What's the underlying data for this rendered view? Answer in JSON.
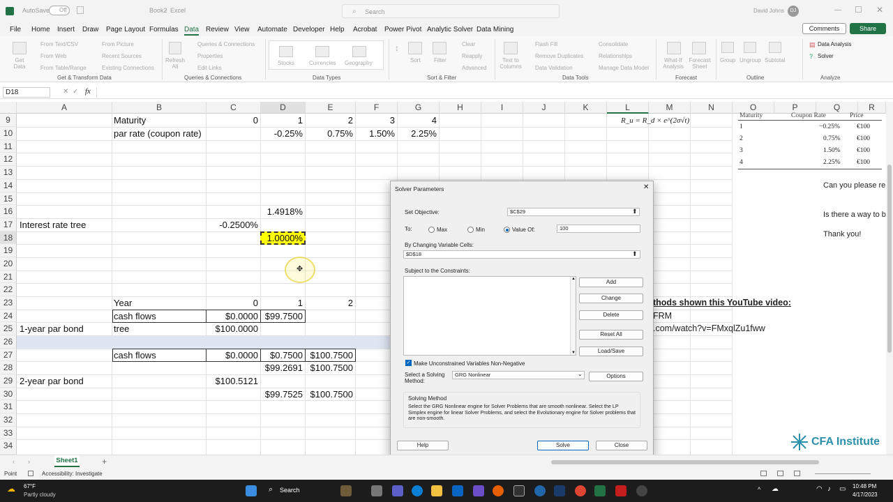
{
  "titlebar": {
    "autosave": "AutoSave",
    "autosave_state": "Off",
    "filename": "Book2",
    "app": "Excel",
    "search": "Search",
    "user": "David Johns",
    "initials": "DJ"
  },
  "menu": [
    "File",
    "Home",
    "Insert",
    "Draw",
    "Page Layout",
    "Formulas",
    "Data",
    "Review",
    "View",
    "Automate",
    "Developer",
    "Help",
    "Acrobat",
    "Power Pivot",
    "Analytic Solver",
    "Data Mining"
  ],
  "menu_right": {
    "comments": "Comments",
    "share": "Share"
  },
  "ribbon": {
    "get_data": "Get Data",
    "from_text": "From Text/CSV",
    "from_web": "From Web",
    "from_table": "From Table/Range",
    "from_picture": "From Picture",
    "recent_sources": "Recent Sources",
    "existing_connections": "Existing Connections",
    "refresh_all": "Refresh All",
    "queries": "Queries & Connections",
    "properties": "Properties",
    "edit_links": "Edit Links",
    "stocks": "Stocks",
    "currencies": "Currencies",
    "geography": "Geography",
    "sort": "Sort",
    "filter": "Filter",
    "clear": "Clear",
    "reapply": "Reapply",
    "advanced": "Advanced",
    "text_to_columns": "Text to Columns",
    "flash_fill": "Flash Fill",
    "remove_duplicates": "Remove Duplicates",
    "data_validation": "Data Validation",
    "consolidate": "Consolidate",
    "relationships": "Relationships",
    "manage_model": "Manage Data Model",
    "what_if": "What-If Analysis",
    "forecast_sheet": "Forecast Sheet",
    "group": "Group",
    "ungroup": "Ungroup",
    "subtotal": "Subtotal",
    "data_analysis": "Data Analysis",
    "solver": "Solver",
    "groups": [
      "Get & Transform Data",
      "Queries & Connections",
      "Data Types",
      "Sort & Filter",
      "Data Tools",
      "Forecast",
      "Outline",
      "Analyze"
    ]
  },
  "formula_bar": {
    "name_box": "D18",
    "fx": "fx",
    "value": ""
  },
  "columns": [
    "A",
    "B",
    "C",
    "D",
    "E",
    "F",
    "G",
    "H",
    "I",
    "J",
    "K",
    "L",
    "M",
    "N",
    "O",
    "P",
    "Q",
    "R"
  ],
  "rows": [
    "9",
    "10",
    "11",
    "12",
    "13",
    "14",
    "15",
    "16",
    "17",
    "18",
    "19",
    "20",
    "21",
    "22",
    "23",
    "24",
    "25",
    "26",
    "27",
    "28",
    "29",
    "30",
    "31",
    "32",
    "33",
    "34"
  ],
  "cells": {
    "b9": "Maturity",
    "c9": "0",
    "d9": "1",
    "e9": "2",
    "f9": "3",
    "g9": "4",
    "b10": "par rate (coupon rate)",
    "d10": "-0.25%",
    "e10": "0.75%",
    "f10": "1.50%",
    "g10": "2.25%",
    "d16": "1.4918%",
    "a17": "Interest rate tree",
    "c17": "-0.2500%",
    "d18": "1.0000%",
    "b23": "Year",
    "c23": "0",
    "d23": "1",
    "e23": "2",
    "b24": "cash flows",
    "c24": "$0.0000",
    "d24": "$99.7500",
    "a25": "1-year par bond",
    "b25": "tree",
    "c25": "$100.0000",
    "b27": "cash flows",
    "c27": "$0.0000",
    "d27": "$0.7500",
    "e27": "$100.7500",
    "d28": "$99.2691",
    "e28": "$100.7500",
    "a29": "2-year par bond",
    "c29": "$100.5121",
    "d30": "$99.7525",
    "e30": "$100.7500"
  },
  "right_panel": {
    "formula": "R_u = R_d × e^(2σ√t)",
    "table_headers": [
      "Maturity",
      "Coupon Rate",
      "Price"
    ],
    "table_rows": [
      [
        "1",
        "−0.25%",
        "€100"
      ],
      [
        "2",
        "0.75%",
        "€100"
      ],
      [
        "3",
        "1.50%",
        "€100"
      ],
      [
        "4",
        "2.25%",
        "€100"
      ]
    ],
    "note1": "Can you please re",
    "note2": "Is there a way to b",
    "note3": "Thank you!",
    "video1": "thods shown this YouTube video:",
    "video2": "FRM",
    "video3": ".com/watch?v=FMxqlZu1fww",
    "brand": "CFA Institute"
  },
  "dialog": {
    "title": "Solver Parameters",
    "set_objective_label": "Set Objective:",
    "set_objective": "$C$29",
    "to_label": "To:",
    "max": "Max",
    "min": "Min",
    "value_of": "Value Of:",
    "value": "100",
    "changing_label": "By Changing Variable Cells:",
    "changing": "$D$18",
    "constraints_label": "Subject to the Constraints:",
    "add": "Add",
    "change": "Change",
    "delete": "Delete",
    "reset_all": "Reset All",
    "load_save": "Load/Save",
    "nonneg": "Make Unconstrained Variables Non-Negative",
    "method_label": "Select a Solving Method:",
    "method": "GRG Nonlinear",
    "options": "Options",
    "solving_method_title": "Solving Method",
    "solving_method_text": "Select the GRG Nonlinear engine for Solver Problems that are smooth nonlinear. Select the LP Simplex engine for linear Solver Problems, and select the Evolutionary engine for Solver problems that are non-smooth.",
    "help": "Help",
    "solve": "Solve",
    "close": "Close"
  },
  "sheet_tab": "Sheet1",
  "status": {
    "mode": "Point",
    "accessibility": "Accessibility: Investigate"
  },
  "taskbar": {
    "temp": "67°F",
    "weather": "Partly cloudy",
    "search": "Search",
    "time": "10:48 PM",
    "date": "4/17/2023"
  }
}
